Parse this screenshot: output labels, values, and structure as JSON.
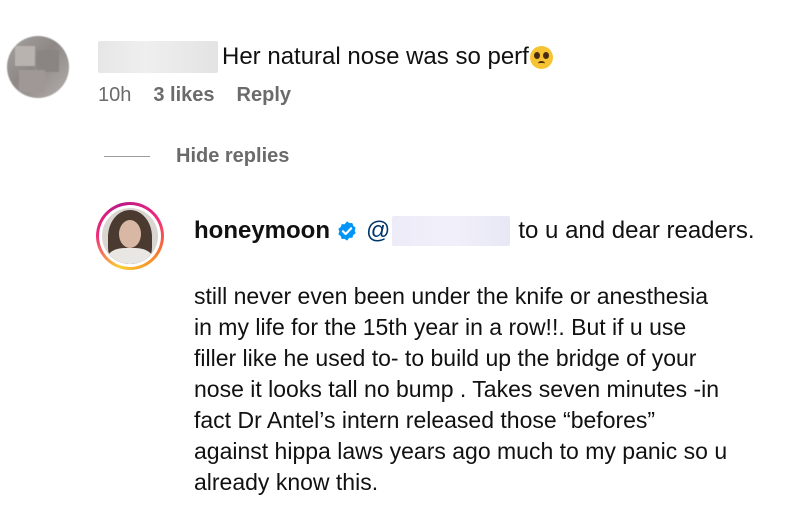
{
  "top_comment": {
    "text": "Her natural nose was so perf",
    "emoji": "pleading-face-emoji",
    "time": "10h",
    "likes": "3 likes",
    "reply_label": "Reply"
  },
  "replies_toggle": {
    "label": "Hide replies"
  },
  "reply": {
    "username": "honeymoon",
    "verified_icon": "verified-badge-icon",
    "mention_prefix": "@",
    "header_text": "to u and dear readers.",
    "body_lines": [
      "still never even been under the knife or anesthesia",
      "in my life for the 15th year in a row!!. But if u use",
      "filler like he used to- to build up the bridge of your",
      "nose it looks tall no bump . Takes seven minutes -in",
      "fact Dr Antel’s intern released those “befores”",
      "against hippa laws years ago much to my panic so u",
      "already know this."
    ]
  },
  "colors": {
    "text": "#111111",
    "meta": "#6b6b6b",
    "mention": "#00376b",
    "verified": "#0095f6"
  }
}
